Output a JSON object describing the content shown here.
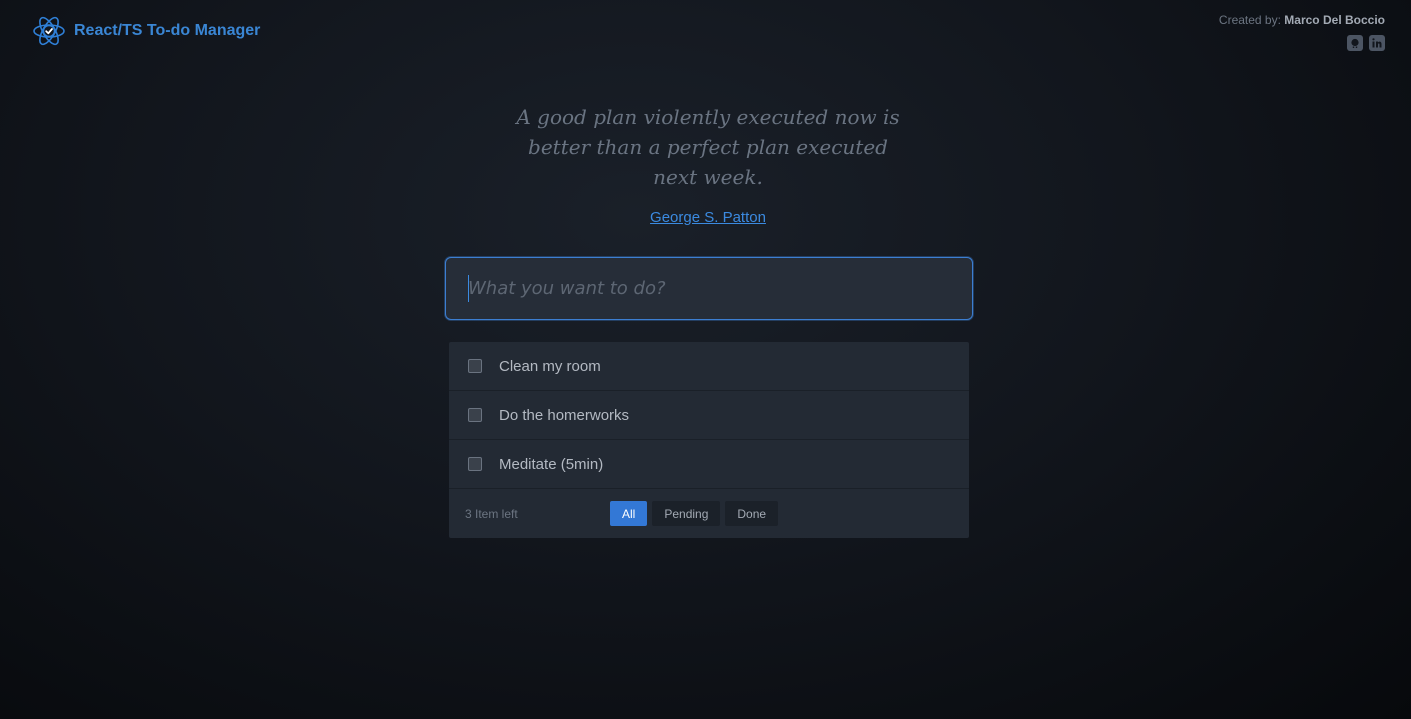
{
  "header": {
    "title": "React/TS To-do Manager",
    "logo_icon": "react-check-icon",
    "credits_prefix": "Created by:",
    "credits_name": "Marco Del Boccio",
    "social": [
      "github-icon",
      "linkedin-icon"
    ]
  },
  "quote": {
    "text": "A good plan violently executed now is better than a perfect plan executed next week.",
    "author": "George S. Patton"
  },
  "input": {
    "placeholder": "What you want to do?",
    "value": ""
  },
  "todos": [
    {
      "label": "Clean my room",
      "done": false
    },
    {
      "label": "Do the homerworks",
      "done": false
    },
    {
      "label": "Meditate (5min)",
      "done": false
    }
  ],
  "footer": {
    "items_left": "3 Item left",
    "filters": {
      "all": "All",
      "pending": "Pending",
      "done": "Done"
    },
    "active_filter": "All"
  },
  "colors": {
    "accent": "#3378d6",
    "brand": "#3a86d4",
    "link": "#3b8ae0"
  }
}
